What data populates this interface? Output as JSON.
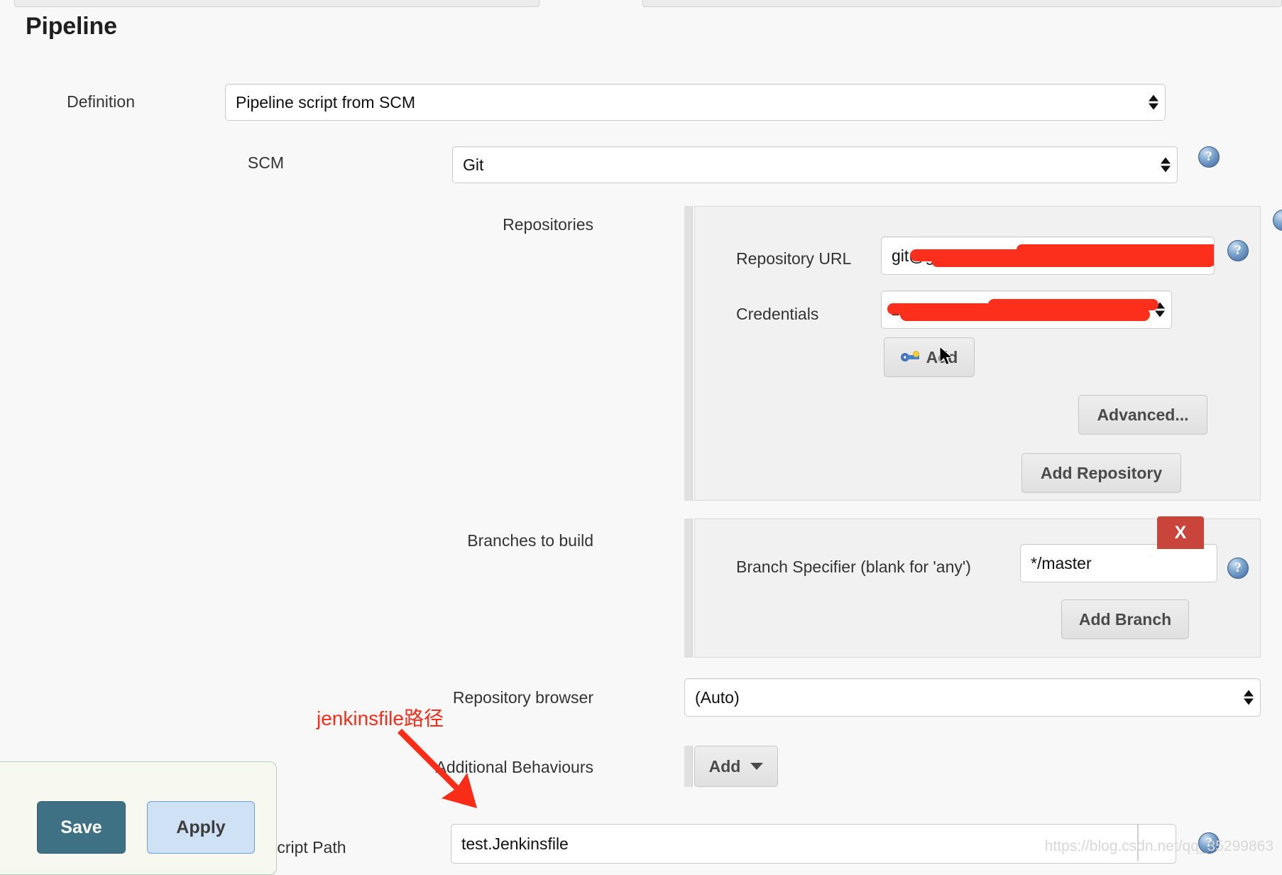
{
  "page": {
    "title": "Pipeline",
    "watermark": "https://blog.csdn.net/qq_35299863"
  },
  "definition": {
    "label": "Definition",
    "value": "Pipeline script from SCM"
  },
  "scm": {
    "label": "SCM",
    "value": "Git",
    "help_icon": "?"
  },
  "repositories": {
    "label": "Repositories",
    "repository_url": {
      "label": "Repository URL",
      "value": "git@gitlab.xxxxx.com.wangxxxxx/SL",
      "redacted": true,
      "help_icon": "?"
    },
    "credentials": {
      "label": "Credentials",
      "value": "zhanglixxxxx xxxxx",
      "redacted": true
    },
    "add_credentials_button": {
      "label": "Add",
      "icon": "key-icon"
    },
    "advanced_button": "Advanced...",
    "add_repository_button": "Add Repository"
  },
  "branches": {
    "label": "Branches to build",
    "delete_button": "X",
    "branch_specifier": {
      "label": "Branch Specifier (blank for 'any')",
      "value": "*/master",
      "help_icon": "?"
    },
    "add_branch_button": "Add Branch"
  },
  "repository_browser": {
    "label": "Repository browser",
    "value": "(Auto)"
  },
  "additional_behaviours": {
    "label": "Additional Behaviours",
    "add_button": "Add"
  },
  "script_path": {
    "label": "Script Path",
    "value": "test.Jenkinsfile",
    "help_icon": "?"
  },
  "annotation": {
    "text": "jenkinsfile路径",
    "color": "#fb2c18"
  },
  "actions": {
    "save": "Save",
    "apply": "Apply"
  },
  "colors": {
    "save_bg": "#3f7185",
    "apply_bg": "#cfe1f5",
    "delete_bg": "#c9443a",
    "redaction": "#fb2f1c",
    "annotation": "#fb2c18"
  }
}
